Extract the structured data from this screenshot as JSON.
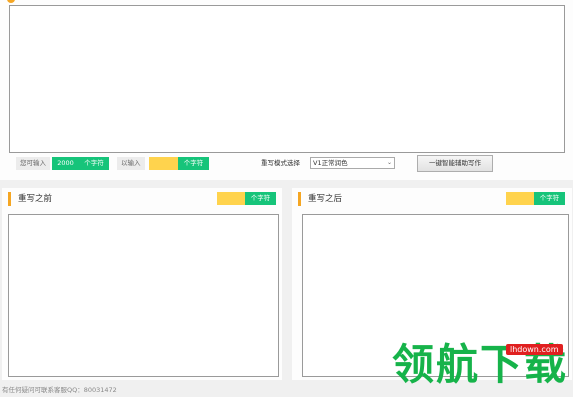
{
  "main_input": {
    "value": ""
  },
  "controls": {
    "can_input_label": "您可输入",
    "can_input_value": "2000",
    "chars_unit": "个字符",
    "entered_label": "以输入",
    "entered_value": "",
    "mode_label": "重写模式选择",
    "mode_value": "V1正常润色",
    "action_button": "一键智能辅助写作"
  },
  "before_pane": {
    "title": "重写之前",
    "count": "",
    "unit": "个字符",
    "value": ""
  },
  "after_pane": {
    "title": "重写之后",
    "count": "",
    "unit": "个字符",
    "value": ""
  },
  "footer": {
    "text": "有任何疑问可联系客服QQ：80031472"
  },
  "watermark": {
    "text": "领航下载",
    "url": "lhdown.com"
  },
  "colors": {
    "accent_orange": "#f5a623",
    "green": "#16c47a",
    "yellow": "#ffd34d",
    "watermark_green": "#16b34a",
    "watermark_red": "#e02020"
  }
}
